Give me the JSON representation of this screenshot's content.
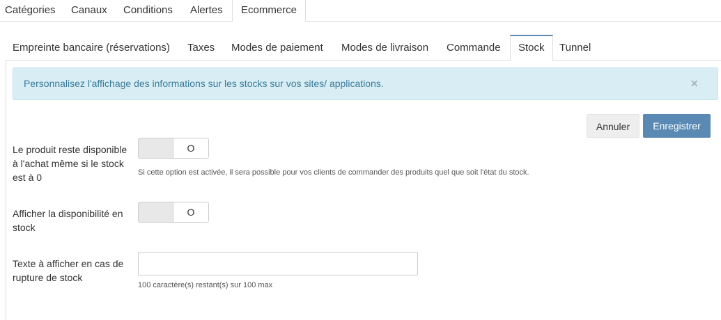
{
  "top_tabs": [
    {
      "label": "Catégories"
    },
    {
      "label": "Canaux"
    },
    {
      "label": "Conditions"
    },
    {
      "label": "Alertes"
    },
    {
      "label": "Ecommerce",
      "active": true
    }
  ],
  "sub_tabs": [
    {
      "label": "Empreinte bancaire (réservations)"
    },
    {
      "label": "Taxes"
    },
    {
      "label": "Modes de paiement"
    },
    {
      "label": "Modes de livraison"
    },
    {
      "label": "Commande"
    },
    {
      "label": "Stock",
      "active": true
    },
    {
      "label": "Tunnel"
    }
  ],
  "alert": {
    "text": "Personnalisez l'affichage des informations sur les stocks sur vos sites/ applications.",
    "close": "×"
  },
  "actions": {
    "cancel_label": "Annuler",
    "save_label": "Enregistrer"
  },
  "form": {
    "out_of_stock_purchase": {
      "label": "Le produit reste disponible à l'achat même si le stock est à 0",
      "state": "O",
      "help": "Si cette option est activée, il sera possible pour vos clients de commander des produits quel que soit l'état du stock."
    },
    "show_availability": {
      "label": "Afficher la disponibilité en stock",
      "state": "O"
    },
    "out_of_stock_text": {
      "label": "Texte à afficher en cas de rupture de stock",
      "value": "",
      "counter": "100 caractère(s) restant(s) sur 100 max"
    }
  },
  "colors": {
    "accent": "#5a8ab4",
    "alert_bg": "#d9eef4",
    "alert_text": "#3a7a9a"
  }
}
